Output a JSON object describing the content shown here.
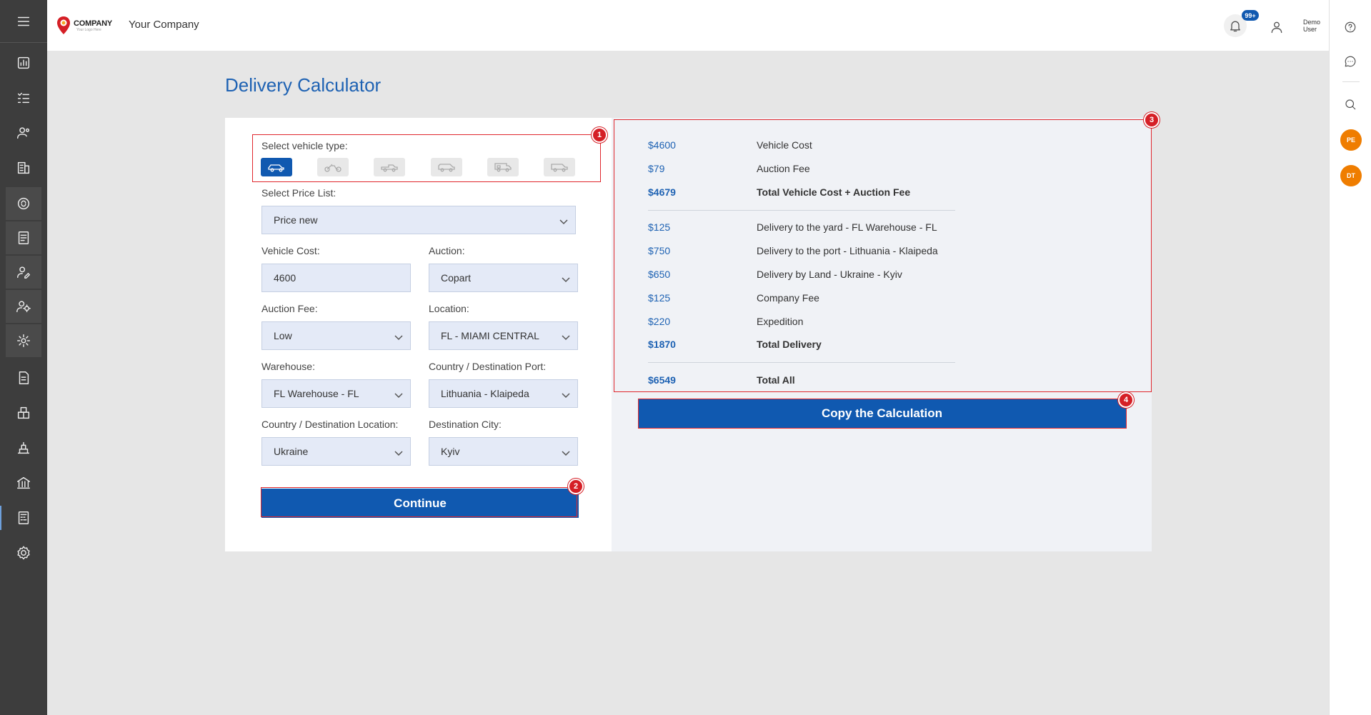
{
  "header": {
    "logo_main": "COMPANY",
    "logo_sub": "Your Logo Here",
    "company_name": "Your Company",
    "notification_badge": "99+",
    "user_name": "Demo User"
  },
  "page": {
    "title": "Delivery Calculator"
  },
  "form": {
    "vehicle_type_label": "Select vehicle type:",
    "vehicle_types": [
      "car",
      "motorcycle",
      "pickup",
      "suv",
      "rv",
      "van"
    ],
    "selected_vehicle_type": "car",
    "price_list_label": "Select Price List:",
    "price_list_value": "Price new",
    "vehicle_cost_label": "Vehicle Cost:",
    "vehicle_cost_value": "4600",
    "auction_label": "Auction:",
    "auction_value": "Copart",
    "auction_fee_label": "Auction Fee:",
    "auction_fee_value": "Low",
    "location_label": "Location:",
    "location_value": "FL - MIAMI CENTRAL",
    "warehouse_label": "Warehouse:",
    "warehouse_value": "FL Warehouse - FL",
    "dest_port_label": "Country / Destination Port:",
    "dest_port_value": "Lithuania - Klaipeda",
    "dest_location_label": "Country / Destination Location:",
    "dest_location_value": "Ukraine",
    "dest_city_label": "Destination City:",
    "dest_city_value": "Kyiv",
    "continue_label": "Continue"
  },
  "results": {
    "rows": [
      {
        "amount": "$4600",
        "label": "Vehicle Cost",
        "bold": false
      },
      {
        "amount": "$79",
        "label": "Auction Fee",
        "bold": false
      },
      {
        "amount": "$4679",
        "label": "Total Vehicle Cost + Auction Fee",
        "bold": true
      },
      {
        "amount": "$125",
        "label": "Delivery to the yard - FL Warehouse - FL",
        "bold": false
      },
      {
        "amount": "$750",
        "label": "Delivery to the port - Lithuania - Klaipeda",
        "bold": false
      },
      {
        "amount": "$650",
        "label": "Delivery by Land - Ukraine - Kyiv",
        "bold": false
      },
      {
        "amount": "$125",
        "label": "Company Fee",
        "bold": false
      },
      {
        "amount": "$220",
        "label": "Expedition",
        "bold": false
      },
      {
        "amount": "$1870",
        "label": "Total Delivery",
        "bold": true
      },
      {
        "amount": "$6549",
        "label": "Total All",
        "bold": true
      }
    ],
    "copy_label": "Copy the Calculation"
  },
  "annotations": [
    "1",
    "2",
    "3",
    "4"
  ],
  "right_sidebar": {
    "avatars": [
      "PE",
      "DT"
    ]
  },
  "colors": {
    "accent": "#1059b0",
    "sidebar": "#3d3d3d",
    "annotation": "#e0272d",
    "avatar": "#ef7d00"
  }
}
